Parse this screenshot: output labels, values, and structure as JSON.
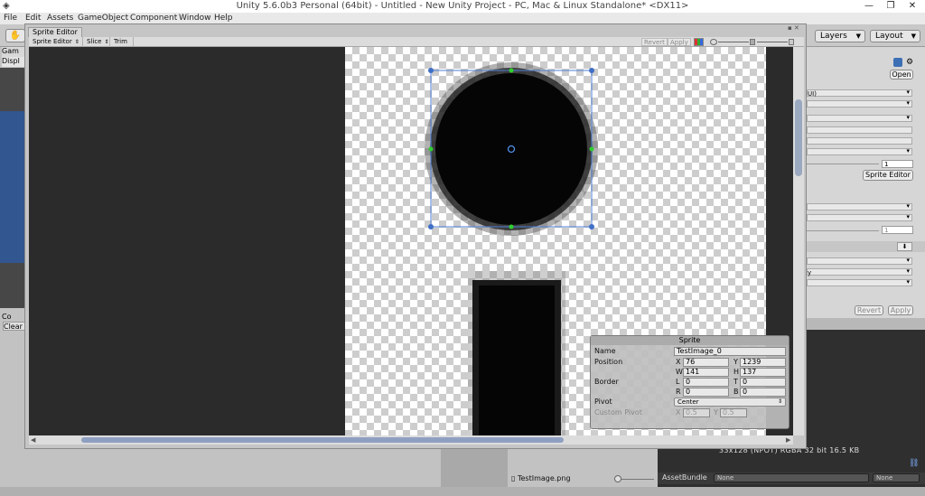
{
  "window": {
    "title": "Unity 5.6.0b3 Personal (64bit) - Untitled - New Unity Project - PC, Mac & Linux Standalone* <DX11>",
    "minimize": "—",
    "maximize": "❐",
    "close": "✕"
  },
  "menu": [
    "File",
    "Edit",
    "Assets",
    "GameObject",
    "Component",
    "Window",
    "Help"
  ],
  "toolbar": {
    "layers": "Layers",
    "layout": "Layout"
  },
  "left_panel": {
    "game_tab": "Gam",
    "display": "Displ",
    "console_tab": "Co",
    "clear": "Clear"
  },
  "sprite_editor": {
    "tab_title": "Sprite Editor",
    "mode_dropdown": "Sprite Editor",
    "slice": "Slice",
    "trim": "Trim",
    "revert": "Revert",
    "apply": "Apply"
  },
  "sprite_panel": {
    "header": "Sprite",
    "name_label": "Name",
    "name_value": "TestImage_0",
    "position_label": "Position",
    "x_label": "X",
    "x_value": "76",
    "y_label": "Y",
    "y_value": "1239",
    "w_label": "W",
    "w_value": "141",
    "h_label": "H",
    "h_value": "137",
    "border_label": "Border",
    "l_label": "L",
    "l_value": "0",
    "t_label": "T",
    "t_value": "0",
    "r_label": "R",
    "r_value": "0",
    "b_label": "B",
    "b_value": "0",
    "pivot_label": "Pivot",
    "pivot_value": "Center",
    "custom_pivot_label": "Custom Pivot",
    "cp_x_label": "X",
    "cp_x_value": "0.5",
    "cp_y_label": "Y",
    "cp_y_value": "0.5"
  },
  "inspector": {
    "open": "Open",
    "ui_dropdown": "UI)",
    "pixels_value": "1",
    "sprite_editor_button": "Sprite Editor",
    "value_1": "1",
    "y_dropdown": "y",
    "revert": "Revert",
    "apply": "Apply"
  },
  "preview": {
    "info": "33x128 (NPOT)  RGBA 32 bit   16.5 KB",
    "asset_bundle_label": "AssetBundle",
    "asset_bundle_value": "None",
    "variant_value": "None"
  },
  "project": {
    "file_name": "TestImage.png"
  }
}
